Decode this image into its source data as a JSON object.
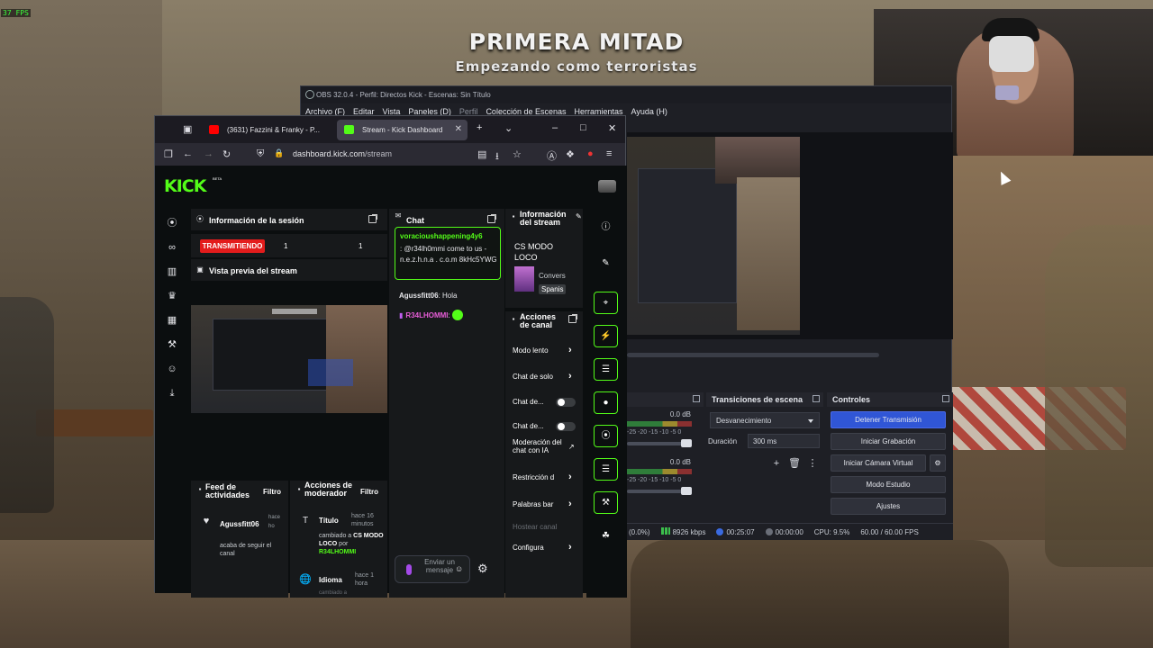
{
  "fps": "37 FPS",
  "overlay": {
    "title": "PRIMERA MITAD",
    "subtitle": "Empezando como terroristas"
  },
  "obs": {
    "title": "OBS 32.0.4 - Perfil: Directos Kick - Escenas: Sin Título",
    "menu": [
      "Archivo (F)",
      "Editar",
      "Vista",
      "Paneles (D)",
      "Perfil",
      "Colección de Escenas",
      "Herramientas",
      "Ayuda (H)"
    ],
    "audio": {
      "db1": "0.0 dB",
      "db2": "0.0 dB",
      "scale": "-25 -20 -15 -10 -5 0"
    },
    "transitions": {
      "title": "Transiciones de escena",
      "selected": "Desvanecimiento",
      "duration_label": "Duración",
      "duration_value": "300 ms"
    },
    "controls": {
      "title": "Controles",
      "buttons": [
        "Detener Transmisión",
        "Iniciar Grabación",
        "Iniciar Cámara Virtual",
        "Modo Estudio",
        "Ajustes"
      ]
    },
    "status": {
      "dropped": "(0.0%)",
      "bitrate": "8926 kbps",
      "stream_time": "00:25:07",
      "rec_time": "00:00:00",
      "cpu": "CPU: 9.5%",
      "fps": "60.00 / 60.00 FPS"
    }
  },
  "browser": {
    "tabs": [
      {
        "label": "(3631) Fazzini & Franky - P..."
      },
      {
        "label": "Stream - Kick Dashboard"
      }
    ],
    "url_host": "dashboard.kick.com",
    "url_path": "/stream"
  },
  "kick": {
    "logo": "KICK",
    "beta": "BETA",
    "session": {
      "title": "Información de la sesión",
      "live_badge": "TRANSMITIENDO",
      "stat1": "1",
      "stat2": "1",
      "preview_title": "Vista previa del stream"
    },
    "chat": {
      "title": "Chat",
      "pinned_user": "voracioushappening4y6",
      "pinned_msg": ": @r34lh0mmi come to us - n.e.z.h.n.a . c.o.m 8kHc5YWG",
      "line1_user": "Agussfitt06",
      "line1_msg": ": Hola",
      "line2_user": "R34LHOMMI",
      "input_placeholder": "Enviar un mensaje"
    },
    "stream_info": {
      "title": "Información del stream",
      "stream_title": "CS MODO LOCO",
      "category_short": "Convers",
      "language_short": "Spanis"
    },
    "channel_actions": {
      "title": "Acciones de canal",
      "items": [
        "Modo lento",
        "Chat de solo",
        "Chat de...",
        "Chat de...",
        "Moderación del chat con IA",
        "Restricción d",
        "Palabras bar",
        "Hostear canal",
        "Configura"
      ]
    },
    "feed": {
      "title": "Feed de actividades",
      "filter": "Filtro",
      "user": "Agussfitt06",
      "action": "acaba de seguir el canal",
      "time": "hace ho"
    },
    "mod": {
      "title": "Acciones de moderador",
      "filter": "Filtro",
      "item1_label": "Título",
      "item1_time": "hace 16 minutos",
      "item1_desc_a": "cambiado a ",
      "item1_desc_b": "CS MODO LOCO",
      "item1_desc_c": " por ",
      "item1_desc_user": "R34LHOMMI",
      "item2_label": "Idioma",
      "item2_time": "hace 1 hora",
      "item2_desc": "cambiado a"
    }
  },
  "colors": {
    "kick_green": "#53fc18",
    "live_red": "#e31c1c",
    "obs_blue": "#3056d6"
  }
}
